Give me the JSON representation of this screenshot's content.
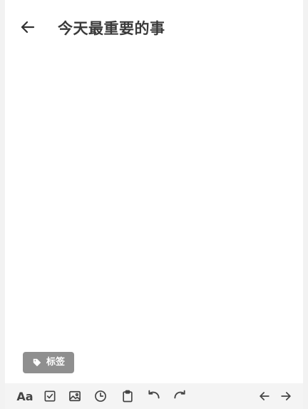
{
  "header": {
    "title": "今天最重要的事",
    "back_icon": "arrow-left-icon"
  },
  "tag": {
    "label": "标签",
    "icon": "tag-icon",
    "color": "#8f8f8f"
  },
  "toolbar": {
    "text_format_label": "Aa",
    "icons": [
      "checkbox-icon",
      "image-icon",
      "clock-icon",
      "clipboard-icon",
      "undo-icon",
      "redo-icon",
      "arrow-left-icon",
      "arrow-right-icon"
    ]
  }
}
